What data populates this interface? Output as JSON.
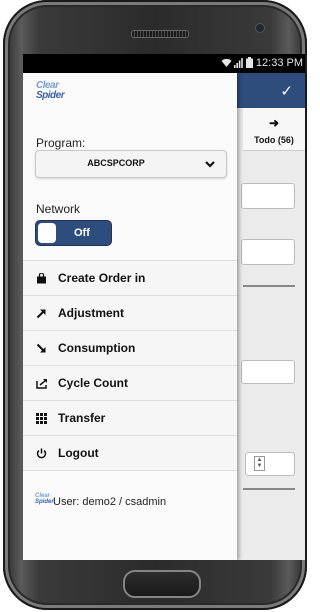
{
  "status": {
    "time": "12:33 PM"
  },
  "app": {
    "todo_label": "Todo (56)",
    "todo_arrow": "➜"
  },
  "drawer": {
    "logo_line1": "Clear",
    "logo_line2": "Spider",
    "program_label": "Program:",
    "program_value": "ABCSPCORP",
    "network_label": "Network",
    "network_toggle": "Off",
    "menu": [
      {
        "label": "Create Order in",
        "icon": "shopping-bag-icon"
      },
      {
        "label": "Adjustment",
        "icon": "arrow-up-right-icon"
      },
      {
        "label": "Consumption",
        "icon": "arrow-down-right-icon"
      },
      {
        "label": "Cycle Count",
        "icon": "cycle-count-icon"
      },
      {
        "label": "Transfer",
        "icon": "grid-icon"
      },
      {
        "label": "Logout",
        "icon": "power-icon"
      }
    ],
    "user": "User: demo2 / csadmin"
  },
  "colors": {
    "brand": "#2e4d7c",
    "drawer_bg": "#fafafa"
  }
}
